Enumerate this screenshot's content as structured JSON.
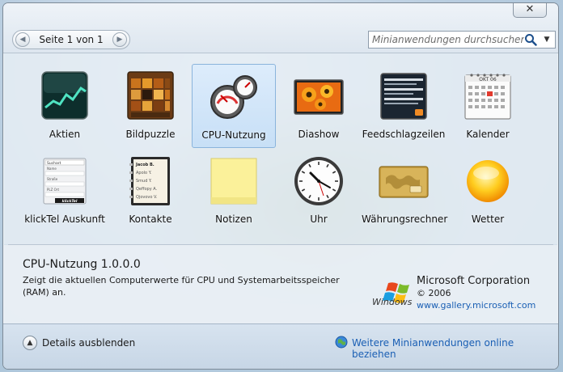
{
  "window": {
    "close_glyph": "✕"
  },
  "pager": {
    "label": "Seite 1 von 1",
    "prev_glyph": "◀",
    "next_glyph": "▶"
  },
  "search": {
    "placeholder": "Minianwendungen durchsuchen",
    "dropdown_glyph": "▼"
  },
  "gadgets": [
    {
      "label": "Aktien",
      "icon": "stocks-icon"
    },
    {
      "label": "Bildpuzzle",
      "icon": "picture-puzzle-icon"
    },
    {
      "label": "CPU-Nutzung",
      "icon": "cpu-meter-icon",
      "selected": true
    },
    {
      "label": "Diashow",
      "icon": "slideshow-icon"
    },
    {
      "label": "Feedschlagzeilen",
      "icon": "feed-headlines-icon"
    },
    {
      "label": "Kalender",
      "icon": "calendar-icon"
    },
    {
      "label": "klickTel Auskunft",
      "icon": "klicktel-icon"
    },
    {
      "label": "Kontakte",
      "icon": "contacts-icon"
    },
    {
      "label": "Notizen",
      "icon": "notes-icon"
    },
    {
      "label": "Uhr",
      "icon": "clock-icon"
    },
    {
      "label": "Währungsrechner",
      "icon": "currency-icon"
    },
    {
      "label": "Wetter",
      "icon": "weather-icon"
    }
  ],
  "icon_text": {
    "calendar_month": "OKT 06",
    "contacts": [
      "Jacob B.",
      "Apolo Y.",
      "Smud Y.",
      "Qeffopy A.",
      "Qjovovo V."
    ],
    "klicktel": [
      "Suchart",
      "Name",
      "Straße",
      "PLZ Ort",
      "klickTel"
    ]
  },
  "details": {
    "title": "CPU-Nutzung 1.0.0.0",
    "description": "Zeigt die aktuellen Computerwerte für CPU und Systemarbeitsspeicher (RAM) an.",
    "company": "Microsoft Corporation",
    "copyright": "© 2006",
    "link": "www.gallery.microsoft.com",
    "logo_word": "Windows"
  },
  "footer": {
    "toggle_label": "Details ausblenden",
    "toggle_glyph": "▲",
    "online_link": "Weitere Minianwendungen online beziehen"
  },
  "colors": {
    "accent": "#1a5fb4",
    "selection": "#c4def7"
  }
}
